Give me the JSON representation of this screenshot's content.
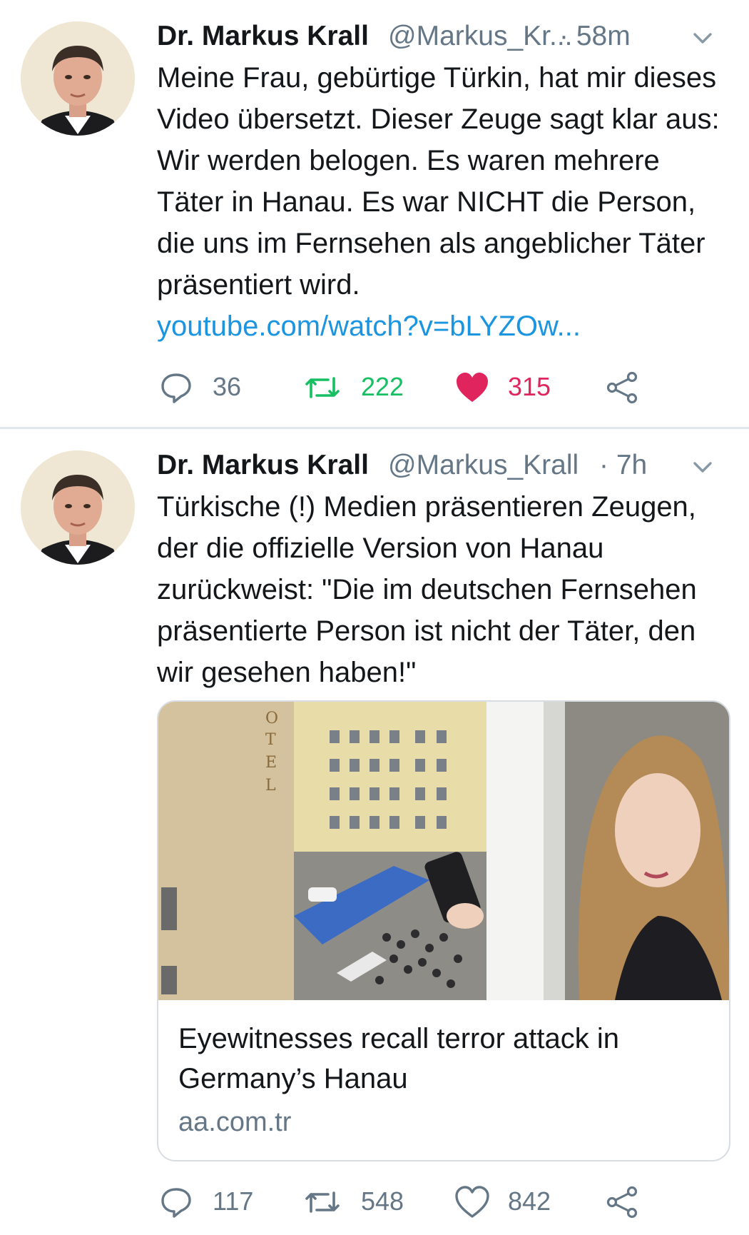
{
  "tweets": [
    {
      "author_name": "Dr. Markus Krall",
      "handle": "@Markus_Kr...",
      "time": "· 58m",
      "text": "Meine Frau, gebürtige Türkin, hat mir dieses Video übersetzt. Dieser Zeuge sagt klar aus: Wir werden belogen. Es waren mehrere Täter in Hanau. Es war NICHT die Person, die uns im Fernsehen als angeblicher Täter präsentiert wird.",
      "link": "youtube.com/watch?v=bLYZOw...",
      "replies": "36",
      "retweets": "222",
      "likes": "315",
      "liked": true,
      "retweeted": true
    },
    {
      "author_name": "Dr. Markus Krall",
      "handle": "@Markus_Krall",
      "time": "· 7h",
      "text": "Türkische (!) Medien präsentieren Zeugen, der die offizielle Version von Hanau zurückweist: \"Die im deutschen Fernsehen präsentierte Person ist nicht der Täter, den wir gesehen haben!\"",
      "card": {
        "title": "Eyewitnesses recall terror attack in Germany’s Hanau",
        "domain": "aa.com.tr"
      },
      "replies": "117",
      "retweets": "548",
      "likes": "842",
      "liked": false,
      "retweeted": false
    }
  ],
  "colors": {
    "link": "#1b95e0",
    "retweet_active": "#17bf63",
    "like_active": "#e0245e",
    "muted": "#657786",
    "text": "#14171a",
    "divider": "#e1e8ed"
  },
  "icons": {
    "reply": "reply-icon",
    "retweet": "retweet-icon",
    "like": "heart-icon",
    "share": "share-icon",
    "menu": "chevron-down-icon"
  }
}
